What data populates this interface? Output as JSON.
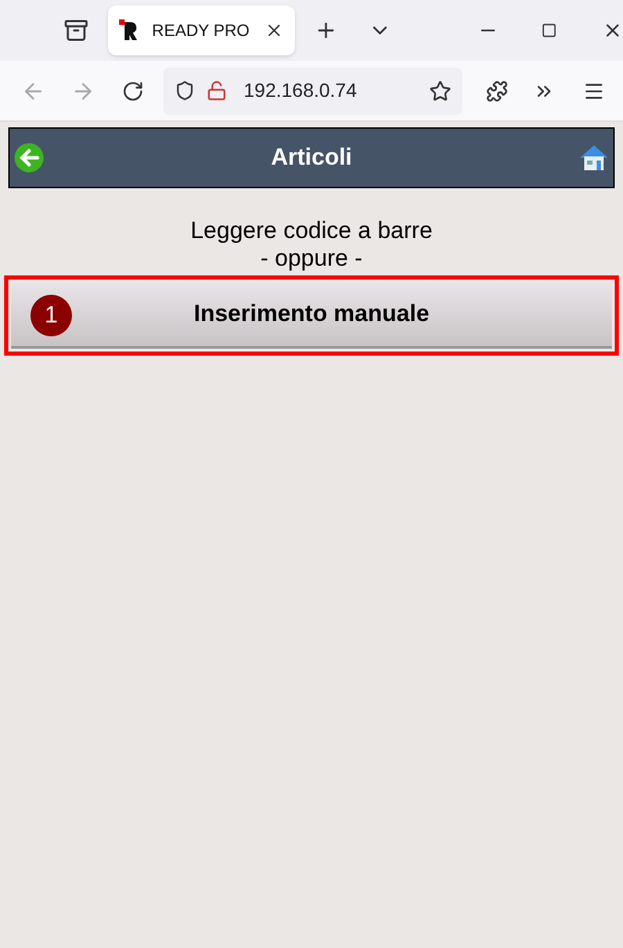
{
  "browser": {
    "tab": {
      "title": "READY PRO"
    },
    "address": "192.168.0.74"
  },
  "header": {
    "title": "Articoli"
  },
  "instructions": [
    "Leggere codice a barre",
    "- oppure -"
  ],
  "button": {
    "label": "Inserimento manuale",
    "badge": "1",
    "highlighted": true
  }
}
